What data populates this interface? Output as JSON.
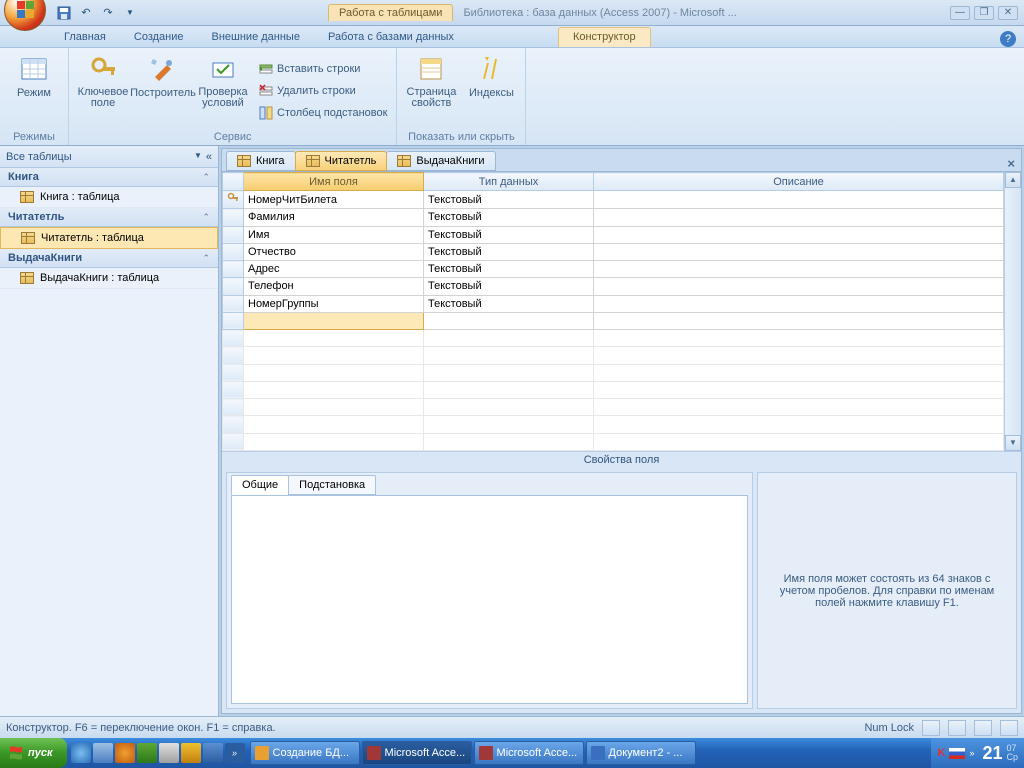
{
  "titlebar": {
    "context_label": "Работа с таблицами",
    "app_title": "Библиотека : база данных (Access 2007) - Microsoft ..."
  },
  "tabs": {
    "home": "Главная",
    "create": "Создание",
    "external": "Внешние данные",
    "dbtools": "Работа с базами данных",
    "design": "Конструктор"
  },
  "ribbon": {
    "group_modes": {
      "view": "Режим",
      "caption": "Режимы"
    },
    "group_service": {
      "key": "Ключевое поле",
      "builder": "Построитель",
      "test": "Проверка условий",
      "insert_rows": "Вставить строки",
      "delete_rows": "Удалить строки",
      "lookup_col": "Столбец подстановок",
      "caption": "Сервис"
    },
    "group_show": {
      "propsheet": "Страница свойств",
      "indexes": "Индексы",
      "caption": "Показать или скрыть"
    }
  },
  "navpane": {
    "header": "Все таблицы",
    "g1": "Книга",
    "g1_item": "Книга : таблица",
    "g2": "Читатетль",
    "g2_item": "Читатетль : таблица",
    "g3": "ВыдачаКниги",
    "g3_item": "ВыдачаКниги : таблица"
  },
  "doctabs": {
    "t1": "Книга",
    "t2": "Читатетль",
    "t3": "ВыдачаКниги"
  },
  "grid": {
    "col_name": "Имя поля",
    "col_type": "Тип данных",
    "col_desc": "Описание",
    "rows": [
      {
        "name": "НомерЧитБилета",
        "type": "Текстовый",
        "key": true
      },
      {
        "name": "Фамилия",
        "type": "Текстовый"
      },
      {
        "name": "Имя",
        "type": "Текстовый"
      },
      {
        "name": "Отчество",
        "type": "Текстовый"
      },
      {
        "name": "Адрес",
        "type": "Текстовый"
      },
      {
        "name": "Телефон",
        "type": "Текстовый"
      },
      {
        "name": "НомерГруппы",
        "type": "Текстовый"
      }
    ]
  },
  "props": {
    "header": "Свойства поля",
    "tab_general": "Общие",
    "tab_lookup": "Подстановка",
    "help_text": "Имя поля может состоять из 64 знаков с учетом пробелов.  Для справки по именам полей нажмите клавишу F1."
  },
  "statusbar": {
    "left": "Конструктор.  F6 = переключение окон.  F1 = справка.",
    "numlock": "Num Lock"
  },
  "taskbar": {
    "start": "пуск",
    "items": [
      "Создание БД...",
      "Microsoft Acce...",
      "Microsoft Acce...",
      "Документ2 - ..."
    ],
    "time": "21",
    "time_sub": "07\nСр"
  }
}
